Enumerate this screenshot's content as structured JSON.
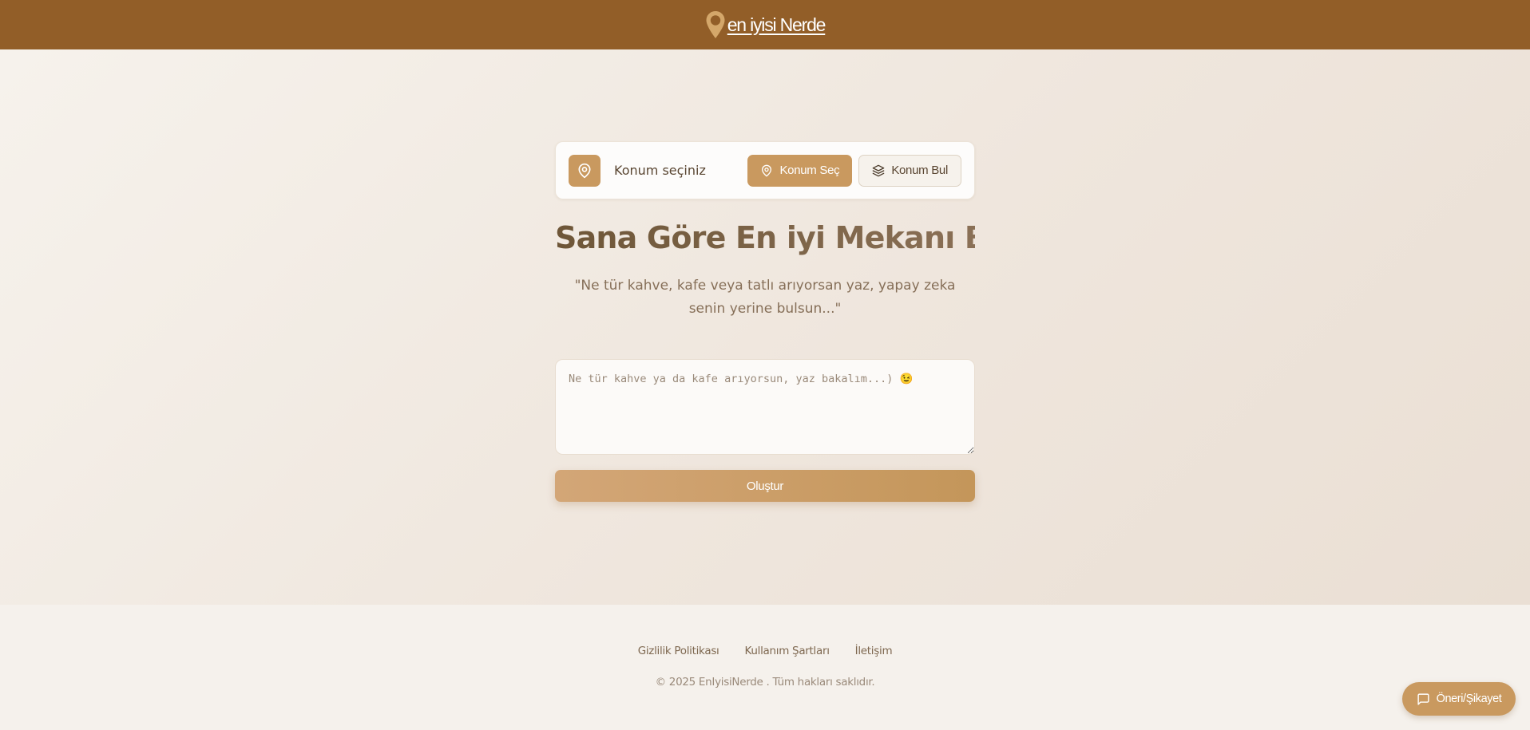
{
  "header": {
    "brand": "en iyisi Nerde",
    "brand_icon": "map-pin-icon"
  },
  "location": {
    "label": "Konum seçiniz",
    "icon": "map-pin-icon",
    "select_button": "Konum Seç",
    "select_icon": "map-pin-icon",
    "find_button": "Konum Bul",
    "find_icon": "layers-icon"
  },
  "hero": {
    "title": "Sana Göre En iyi Mekanı Bul",
    "subtitle": "\"Ne tür kahve, kafe veya tatlı arıyorsan yaz, yapay zeka senin yerine bulsun...\""
  },
  "search": {
    "placeholder": "Ne tür kahve ya da kafe arıyorsun, yaz bakalım...) 😉",
    "value": "",
    "submit": "Oluştur"
  },
  "footer": {
    "links": [
      "Gizlilik Politikası",
      "Kullanım Şartları",
      "İletişim"
    ],
    "copyright": "© 2025 EnIyisiNerde . Tüm hakları saklıdır."
  },
  "feedback": {
    "label": "Öneri/Şikayet",
    "icon": "message-square-icon"
  },
  "colors": {
    "header_bg": "#925e28",
    "accent": "#c9995f",
    "title_start": "#6e5638",
    "title_end": "#8a7056",
    "page_bg": "#f4efe9"
  }
}
